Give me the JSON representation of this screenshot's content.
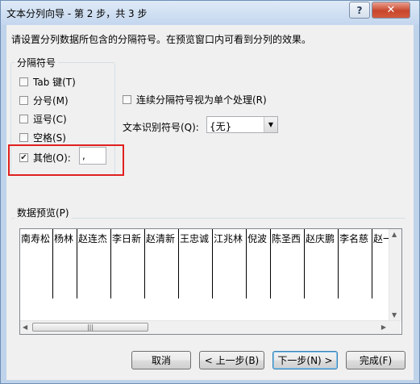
{
  "window": {
    "title": "文本分列向导 - 第 2 步，共 3 步",
    "help_label": "?",
    "close_label": "✕"
  },
  "instruction": "请设置分列数据所包含的分隔符号。在预览窗口内可看到分列的效果。",
  "delimiters": {
    "group_label": "分隔符号",
    "items": [
      {
        "label": "Tab 键(T)",
        "checked": false
      },
      {
        "label": "分号(M)",
        "checked": false
      },
      {
        "label": "逗号(C)",
        "checked": false
      },
      {
        "label": "空格(S)",
        "checked": false
      },
      {
        "label": "其他(O):",
        "checked": true
      }
    ],
    "other_value": ","
  },
  "consecutive": {
    "label": "连续分隔符号视为单个处理(R)",
    "checked": false
  },
  "text_qualifier": {
    "label": "文本识别符号(Q):",
    "value": "{无}"
  },
  "preview": {
    "group_label": "数据预览(P)",
    "columns": [
      "南寿松",
      "杨林",
      "赵连杰",
      "李日新",
      "赵清新",
      "王忠诚",
      "江兆林",
      "倪波",
      "陈圣西",
      "赵庆鹏",
      "李名慈",
      "赵一"
    ],
    "thumb_grip": "|||"
  },
  "buttons": {
    "cancel": "取消",
    "back": "< 上一步(B)",
    "next": "下一步(N) >",
    "finish": "完成(F)"
  }
}
